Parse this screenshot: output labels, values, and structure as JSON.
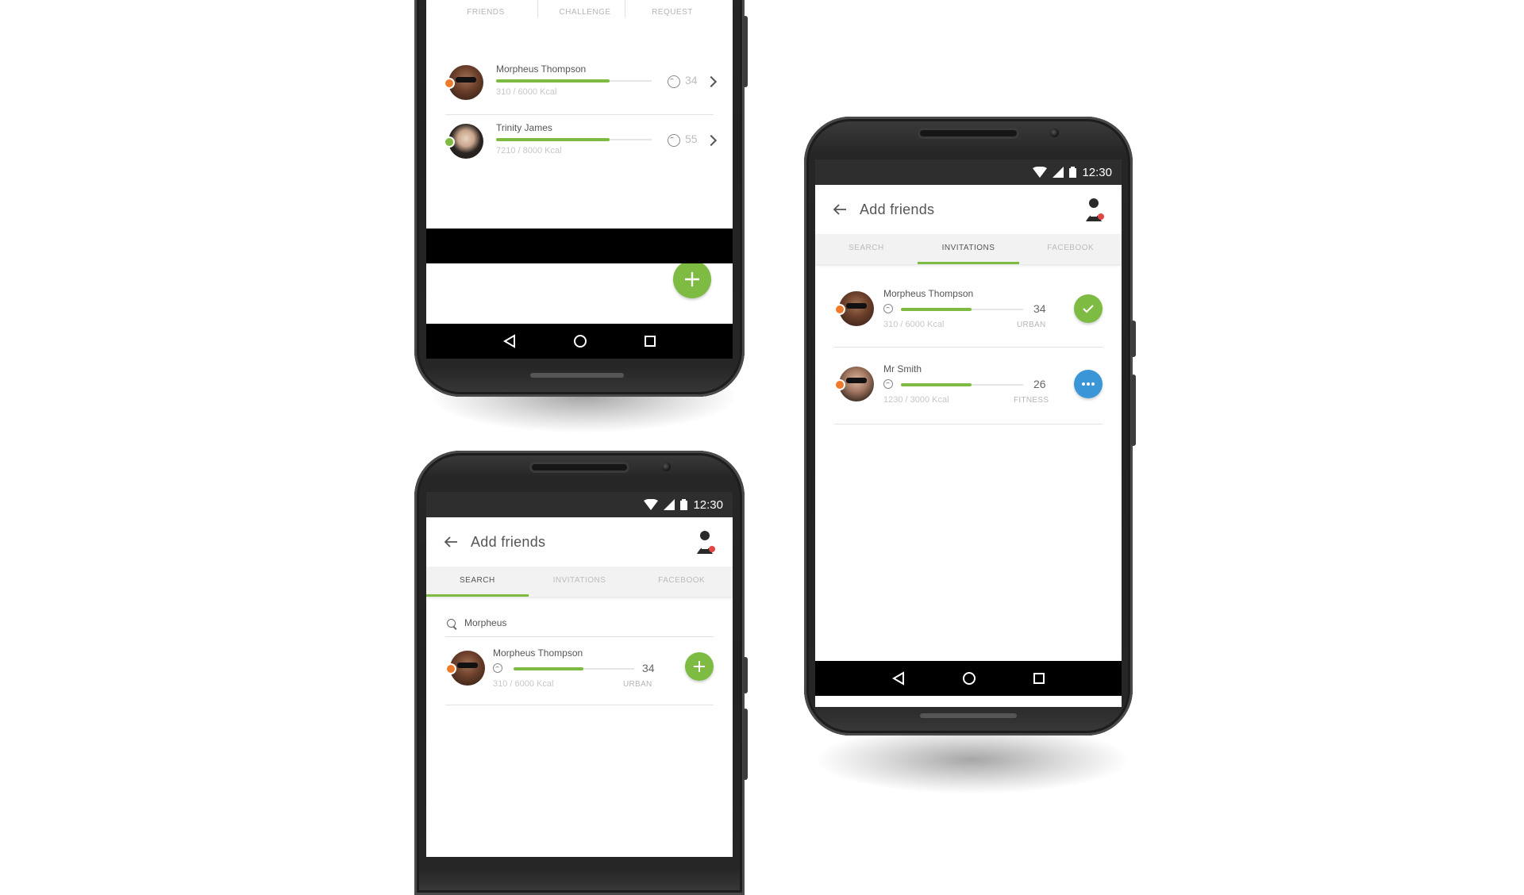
{
  "colors": {
    "accent": "#7dbb42",
    "blue": "#3a96d6",
    "orange_dot": "#f07a2b",
    "green_dot": "#7dbb42"
  },
  "stats": [
    "FRIENDS",
    "CHALLENGE",
    "REQUEST"
  ],
  "phone1": {
    "rows": [
      {
        "name": "Morpheus Thompson",
        "kcal": "310 / 6000 Kcal",
        "level": "34",
        "progress": 0.73,
        "status": "orange"
      },
      {
        "name": "Trinity James",
        "kcal": "7210 / 8000 Kcal",
        "level": "55",
        "progress": 0.73,
        "status": "green"
      }
    ],
    "fab_icon": "plus-icon"
  },
  "phone2": {
    "time": "12:30",
    "title": "Add friends",
    "tabs": [
      "SEARCH",
      "INVITATIONS",
      "FACEBOOK"
    ],
    "active_tab": "INVITATIONS",
    "rows": [
      {
        "name": "Morpheus Thompson",
        "kcal": "310 / 6000 Kcal",
        "level": "34",
        "tag": "URBAN",
        "progress": 0.58,
        "action": "check-icon"
      },
      {
        "name": "Mr Smith",
        "kcal": "1230 / 3000 Kcal",
        "level": "26",
        "tag": "FITNESS",
        "progress": 0.58,
        "action": "more-icon"
      }
    ]
  },
  "phone3": {
    "time": "12:30",
    "title": "Add friends",
    "tabs": [
      "SEARCH",
      "INVITATIONS",
      "FACEBOOK"
    ],
    "active_tab": "SEARCH",
    "search_value": "Morpheus",
    "rows": [
      {
        "name": "Morpheus Thompson",
        "kcal": "310 / 6000 Kcal",
        "level": "34",
        "tag": "URBAN",
        "progress": 0.58,
        "action": "plus-icon"
      }
    ]
  }
}
